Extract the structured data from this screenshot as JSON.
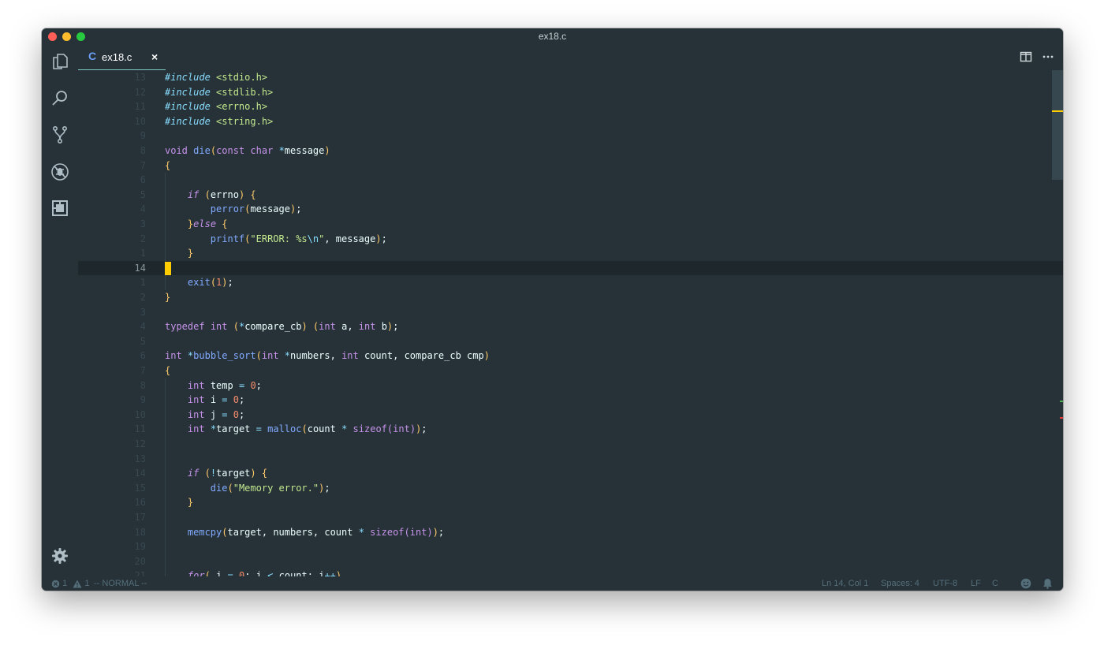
{
  "window": {
    "title": "ex18.c"
  },
  "tabs": [
    {
      "lang_icon": "C",
      "label": "ex18.c",
      "close": "×"
    }
  ],
  "activity_icons": [
    "files-icon",
    "search-icon",
    "source-control-icon",
    "debug-icon",
    "extensions-icon",
    "gear-icon"
  ],
  "editor": {
    "current_line_number": "14",
    "lines": [
      {
        "ln": "13",
        "code": "#include <stdio.h>"
      },
      {
        "ln": "12",
        "code": "#include <stdlib.h>"
      },
      {
        "ln": "11",
        "code": "#include <errno.h>"
      },
      {
        "ln": "10",
        "code": "#include <string.h>"
      },
      {
        "ln": "9",
        "code": ""
      },
      {
        "ln": "8",
        "code": "void die(const char *message)"
      },
      {
        "ln": "7",
        "code": "{"
      },
      {
        "ln": "6",
        "code": ""
      },
      {
        "ln": "5",
        "code": "    if (errno) {"
      },
      {
        "ln": "4",
        "code": "        perror(message);"
      },
      {
        "ln": "3",
        "code": "    }else {"
      },
      {
        "ln": "2",
        "code": "        printf(\"ERROR: %s\\n\", message);"
      },
      {
        "ln": "1",
        "code": "    }"
      },
      {
        "ln": "14",
        "code": ""
      },
      {
        "ln": "1",
        "code": "    exit(1);"
      },
      {
        "ln": "2",
        "code": "}"
      },
      {
        "ln": "3",
        "code": ""
      },
      {
        "ln": "4",
        "code": "typedef int (*compare_cb) (int a, int b);"
      },
      {
        "ln": "5",
        "code": ""
      },
      {
        "ln": "6",
        "code": "int *bubble_sort(int *numbers, int count, compare_cb cmp)"
      },
      {
        "ln": "7",
        "code": "{"
      },
      {
        "ln": "8",
        "code": "    int temp = 0;"
      },
      {
        "ln": "9",
        "code": "    int i = 0;"
      },
      {
        "ln": "10",
        "code": "    int j = 0;"
      },
      {
        "ln": "11",
        "code": "    int *target = malloc(count * sizeof(int));"
      },
      {
        "ln": "12",
        "code": ""
      },
      {
        "ln": "13",
        "code": ""
      },
      {
        "ln": "14",
        "code": "    if (!target) {"
      },
      {
        "ln": "15",
        "code": "        die(\"Memory error.\");"
      },
      {
        "ln": "16",
        "code": "    }"
      },
      {
        "ln": "17",
        "code": ""
      },
      {
        "ln": "18",
        "code": "    memcpy(target, numbers, count * sizeof(int));"
      },
      {
        "ln": "19",
        "code": ""
      },
      {
        "ln": "20",
        "code": ""
      },
      {
        "ln": "21",
        "code": "    for( i = 0; i < count; i++)"
      }
    ]
  },
  "status": {
    "errors": "1",
    "warnings": "1",
    "mode": "-- NORMAL --",
    "position": "Ln 14, Col 1",
    "spaces": "Spaces: 4",
    "encoding": "UTF-8",
    "eol": "LF",
    "language": "C"
  },
  "colors": {
    "background": "#263238",
    "cursor": "#ffcc00",
    "keyword": "#c792ea",
    "function": "#82aaff",
    "string": "#c3e88d",
    "number": "#f78c6c",
    "operator": "#89ddff",
    "tab_accent": "#80cbc4"
  }
}
